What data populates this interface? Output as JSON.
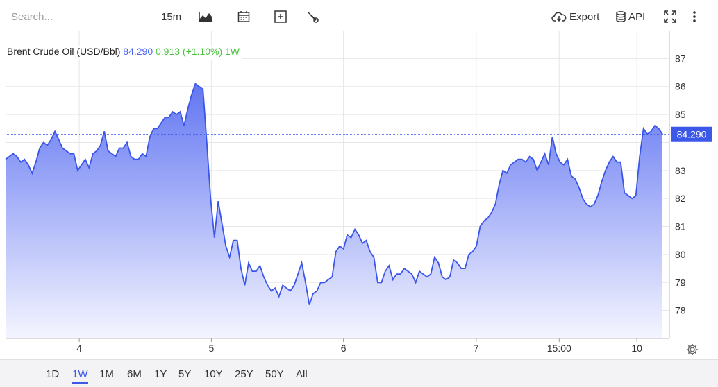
{
  "search": {
    "placeholder": "Search..."
  },
  "toolbar": {
    "interval": "15m",
    "export_label": "Export",
    "api_label": "API",
    "icons": [
      "chart-style-icon",
      "calendar-icon",
      "add-indicator-icon",
      "tools-icon",
      "download-icon",
      "database-icon",
      "fullscreen-icon",
      "more-icon"
    ]
  },
  "legend": {
    "name": "Brent Crude Oil (USD/Bbl)",
    "value": "84.290",
    "change": "0.913 (+1.10%)",
    "period": "1W"
  },
  "ranges": [
    "1D",
    "1W",
    "1M",
    "6M",
    "1Y",
    "5Y",
    "10Y",
    "25Y",
    "50Y",
    "All"
  ],
  "active_range": "1W",
  "colors": {
    "line": "#3a55ea",
    "fill_top": "#6276f2",
    "fill_bottom": "#f4f5ff",
    "up": "#48c23c",
    "price_tag": "#3c58e8"
  },
  "chart_data": {
    "type": "area",
    "title": "Brent Crude Oil (USD/Bbl)",
    "ylim": [
      77,
      88
    ],
    "y_ticks": [
      78,
      79,
      80,
      81,
      82,
      83,
      84,
      85,
      86,
      87
    ],
    "y_tick_labels": [
      "78",
      "79",
      "80",
      "81",
      "82",
      "83",
      "",
      "85",
      "86",
      "87"
    ],
    "x_ticks": [
      {
        "label": "4",
        "t": 0.111
      },
      {
        "label": "5",
        "t": 0.31
      },
      {
        "label": "6",
        "t": 0.509
      },
      {
        "label": "7",
        "t": 0.709
      },
      {
        "label": "15:00",
        "t": 0.834
      },
      {
        "label": "10",
        "t": 0.951
      }
    ],
    "last_price": 84.29,
    "last_price_label": "84.290",
    "grid": true,
    "series": [
      {
        "values": [
          83.4,
          83.5,
          83.6,
          83.5,
          83.3,
          83.4,
          83.2,
          82.9,
          83.3,
          83.8,
          84.0,
          83.9,
          84.1,
          84.4,
          84.1,
          83.8,
          83.7,
          83.6,
          83.6,
          83.0,
          83.2,
          83.4,
          83.1,
          83.6,
          83.7,
          83.9,
          84.4,
          83.7,
          83.6,
          83.5,
          83.8,
          83.8,
          84.0,
          83.5,
          83.4,
          83.4,
          83.6,
          83.5,
          84.2,
          84.5,
          84.5,
          84.7,
          84.9,
          84.9,
          85.1,
          85.0,
          85.1,
          84.6,
          85.2,
          85.7,
          86.1,
          86.0,
          85.9,
          84.0,
          82.0,
          80.6,
          81.9,
          81.1,
          80.3,
          79.9,
          80.5,
          80.5,
          79.5,
          78.9,
          79.7,
          79.4,
          79.4,
          79.6,
          79.2,
          78.9,
          78.7,
          78.8,
          78.5,
          78.9,
          78.8,
          78.7,
          78.9,
          79.3,
          79.7,
          79.0,
          78.2,
          78.6,
          78.7,
          79.0,
          79.0,
          79.1,
          79.2,
          80.1,
          80.3,
          80.2,
          80.7,
          80.6,
          80.9,
          80.7,
          80.4,
          80.5,
          80.1,
          79.9,
          79.0,
          79.0,
          79.4,
          79.6,
          79.1,
          79.3,
          79.3,
          79.5,
          79.4,
          79.3,
          79.0,
          79.4,
          79.3,
          79.2,
          79.3,
          79.9,
          79.7,
          79.2,
          79.1,
          79.2,
          79.8,
          79.7,
          79.5,
          79.5,
          80.0,
          80.1,
          80.3,
          81.0,
          81.2,
          81.3,
          81.5,
          81.8,
          82.5,
          83.0,
          82.9,
          83.2,
          83.3,
          83.4,
          83.4,
          83.3,
          83.5,
          83.4,
          83.0,
          83.3,
          83.6,
          83.2,
          84.2,
          83.6,
          83.3,
          83.2,
          83.4,
          82.8,
          82.7,
          82.4,
          82.0,
          81.8,
          81.7,
          81.8,
          82.1,
          82.6,
          83.0,
          83.3,
          83.5,
          83.3,
          83.3,
          82.2,
          82.1,
          82.0,
          82.1,
          83.5,
          84.5,
          84.3,
          84.4,
          84.6,
          84.5,
          84.3
        ]
      }
    ]
  }
}
